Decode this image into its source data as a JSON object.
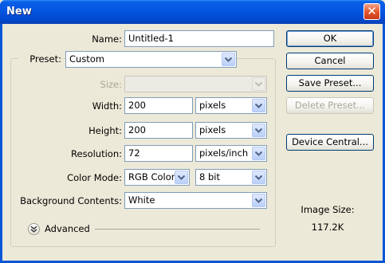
{
  "window": {
    "title": "New",
    "close_glyph": "✕"
  },
  "name": {
    "label": "Name:",
    "value": "Untitled-1"
  },
  "preset": {
    "label": "Preset:",
    "value": "Custom"
  },
  "size": {
    "label": "Size:",
    "value": ""
  },
  "width": {
    "label": "Width:",
    "value": "200",
    "unit": "pixels"
  },
  "height": {
    "label": "Height:",
    "value": "200",
    "unit": "pixels"
  },
  "resolution": {
    "label": "Resolution:",
    "value": "72",
    "unit": "pixels/inch"
  },
  "color_mode": {
    "label": "Color Mode:",
    "value": "RGB Color",
    "depth": "8 bit"
  },
  "background": {
    "label": "Background Contents:",
    "value": "White"
  },
  "advanced": {
    "label": "Advanced"
  },
  "buttons": {
    "ok": "OK",
    "cancel": "Cancel",
    "save_preset": "Save Preset...",
    "delete_preset": "Delete Preset...",
    "device_central": "Device Central..."
  },
  "image_size": {
    "label": "Image Size:",
    "value": "117.2K"
  },
  "colors": {
    "titlebar": "#0555e2",
    "face": "#ece9d8",
    "field_border": "#7f9db9"
  }
}
